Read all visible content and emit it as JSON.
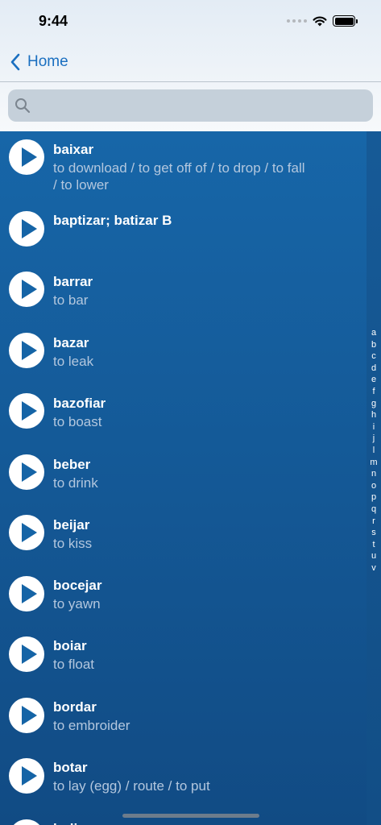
{
  "status_bar": {
    "time": "9:44"
  },
  "nav": {
    "back_label": "Home"
  },
  "search": {
    "placeholder": ""
  },
  "entries": [
    {
      "word": "baixar",
      "translation": "to download / to get off of / to drop / to fall / to lower"
    },
    {
      "word": "baptizar; batizar B",
      "translation": ""
    },
    {
      "word": "barrar",
      "translation": "to bar"
    },
    {
      "word": "bazar",
      "translation": "to leak"
    },
    {
      "word": "bazofiar",
      "translation": "to boast"
    },
    {
      "word": "beber",
      "translation": "to drink"
    },
    {
      "word": "beijar",
      "translation": "to kiss"
    },
    {
      "word": "bocejar",
      "translation": "to yawn"
    },
    {
      "word": "boiar",
      "translation": "to float"
    },
    {
      "word": "bordar",
      "translation": "to embroider"
    },
    {
      "word": "botar",
      "translation": "to lay (egg) / route / to put"
    },
    {
      "word": "bulir",
      "translation": ""
    }
  ],
  "index_letters": [
    "a",
    "b",
    "c",
    "d",
    "e",
    "f",
    "g",
    "h",
    "i",
    "j",
    "l",
    "m",
    "n",
    "o",
    "p",
    "q",
    "r",
    "s",
    "t",
    "u",
    "v"
  ]
}
